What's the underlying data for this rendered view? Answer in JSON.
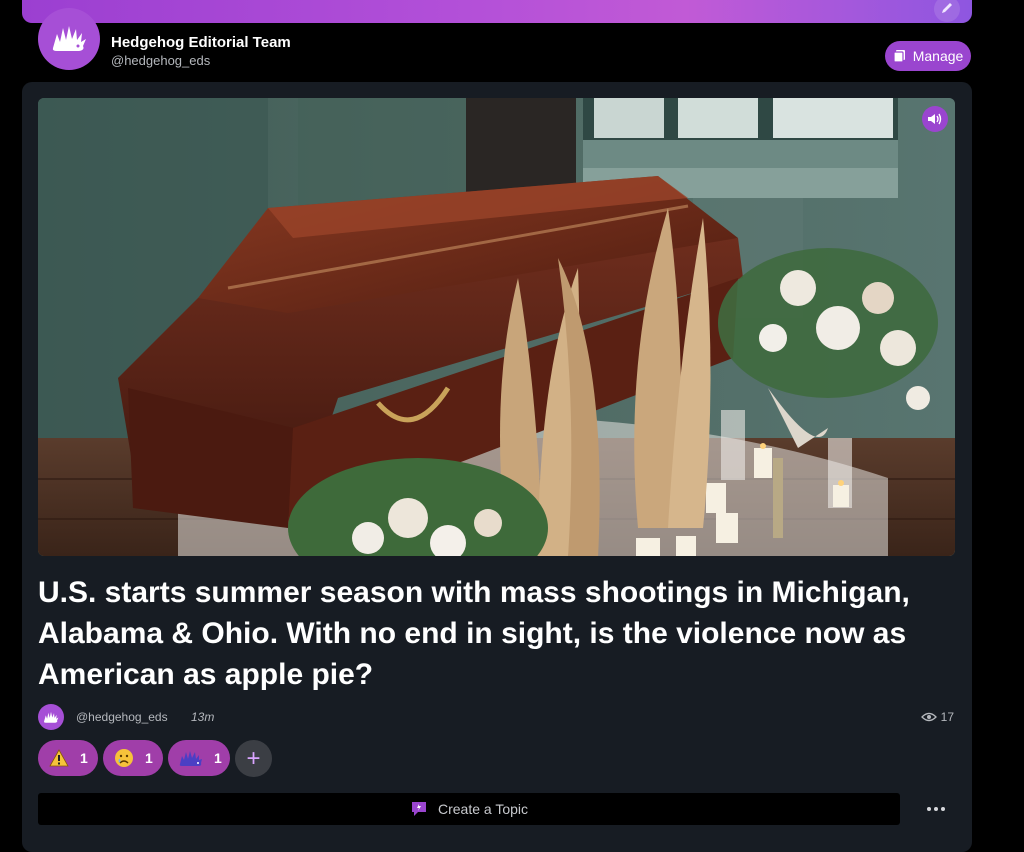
{
  "profile": {
    "name": "Hedgehog Editorial Team",
    "handle": "@hedgehog_eds",
    "manage_label": "Manage"
  },
  "post": {
    "image_alt": "Wooden casket with candles and flowers",
    "title": "U.S. starts summer season with mass shootings in Michigan, Alabama & Ohio. With no end in sight, is the violence now as American as apple pie?",
    "author_handle": "@hedgehog_eds",
    "time_ago": "13m",
    "views": "17"
  },
  "reactions": [
    {
      "icon": "warning-emoji",
      "count": "1"
    },
    {
      "icon": "sad-emoji",
      "count": "1"
    },
    {
      "icon": "hedgehog-emoji",
      "count": "1"
    }
  ],
  "actions": {
    "create_topic_label": "Create a Topic"
  },
  "colors": {
    "accent": "#9a45cf",
    "card_bg": "#171c23",
    "reaction_bg": "#a03ea9"
  }
}
